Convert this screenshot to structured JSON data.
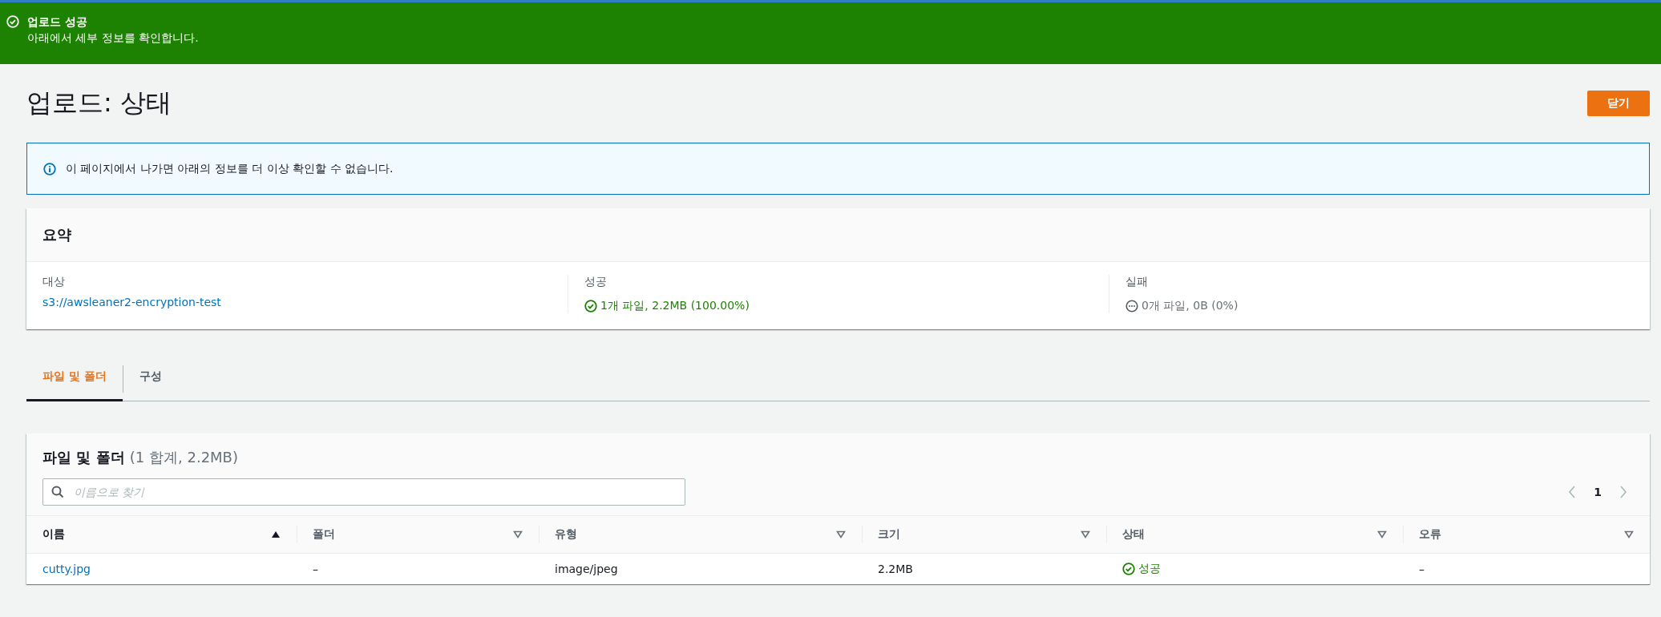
{
  "flash": {
    "kind": "success",
    "title": "업로드 성공",
    "message": "아래에서 세부 정보를 확인합니다."
  },
  "header": {
    "title": "업로드: 상태",
    "close_button": "닫기"
  },
  "info_alert": {
    "text": "이 페이지에서 나가면 아래의 정보를 더 이상 확인할 수 없습니다."
  },
  "summary": {
    "title": "요약",
    "items": [
      {
        "label": "대상",
        "value": "s3://awsleaner2-encryption-test",
        "kind": "link"
      },
      {
        "label": "성공",
        "value": "1개 파일, 2.2MB (100.00%)",
        "kind": "success"
      },
      {
        "label": "실패",
        "value": "0개 파일, 0B (0%)",
        "kind": "none"
      }
    ]
  },
  "tabs": [
    {
      "label": "파일 및 폴더",
      "selected": true
    },
    {
      "label": "구성",
      "selected": false
    }
  ],
  "files": {
    "title": "파일 및 폴더",
    "count": "(1 합계, 2.2MB)",
    "search": {
      "placeholder": "이름으로 찾기"
    },
    "pagination": {
      "page": "1"
    },
    "columns": [
      {
        "label": "이름",
        "sorted": true
      },
      {
        "label": "폴더",
        "sorted": false
      },
      {
        "label": "유형",
        "sorted": false
      },
      {
        "label": "크기",
        "sorted": false
      },
      {
        "label": "상태",
        "sorted": false
      },
      {
        "label": "오류",
        "sorted": false
      }
    ],
    "rows": [
      {
        "name": "cutty.jpg",
        "folder": "–",
        "type": "image/jpeg",
        "size": "2.2MB",
        "status": "성공",
        "succeeded": true,
        "error": "–"
      }
    ]
  }
}
